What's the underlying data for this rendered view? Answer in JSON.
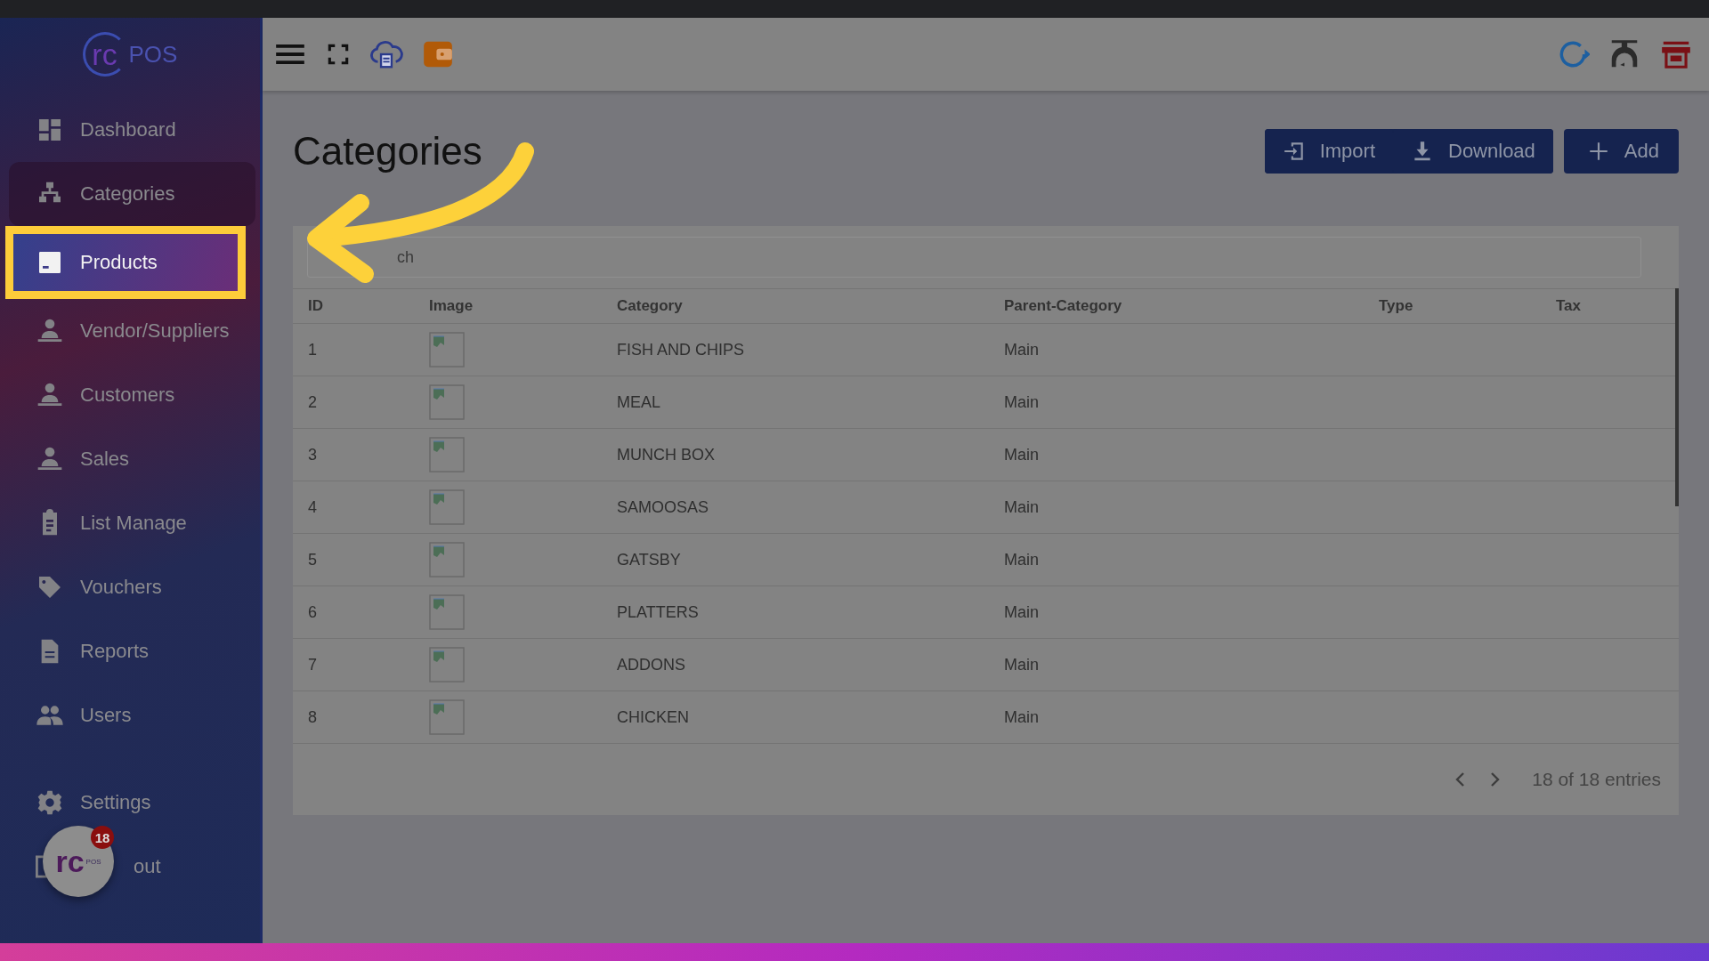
{
  "logo": {
    "mark": "rc",
    "text": "POS"
  },
  "sidebar": {
    "items": [
      {
        "label": "Dashboard",
        "selected": false,
        "hovered": false
      },
      {
        "label": "Categories",
        "selected": false,
        "hovered": true
      },
      {
        "label": "Products",
        "selected": true,
        "hovered": false
      },
      {
        "label": "Vendor/Suppliers",
        "selected": false,
        "hovered": false
      },
      {
        "label": "Customers",
        "selected": false,
        "hovered": false
      },
      {
        "label": "Sales",
        "selected": false,
        "hovered": false
      },
      {
        "label": "List Manage",
        "selected": false,
        "hovered": false
      },
      {
        "label": "Vouchers",
        "selected": false,
        "hovered": false
      },
      {
        "label": "Reports",
        "selected": false,
        "hovered": false
      },
      {
        "label": "Users",
        "selected": false,
        "hovered": false
      }
    ],
    "bottom_items": [
      {
        "label": "Settings"
      },
      {
        "label": "out"
      }
    ]
  },
  "floating_badge": {
    "mark": "rc",
    "text": "POS",
    "count": "18"
  },
  "page": {
    "title": "Categories",
    "buttons": [
      "Import",
      "Download",
      "Add"
    ]
  },
  "search": {
    "placeholder": "ch"
  },
  "table": {
    "columns": [
      "ID",
      "Image",
      "Category",
      "Parent-Category",
      "Type",
      "Tax"
    ],
    "rows": [
      {
        "id": "1",
        "category": "FISH AND CHIPS",
        "parent": "Main"
      },
      {
        "id": "2",
        "category": "MEAL",
        "parent": "Main"
      },
      {
        "id": "3",
        "category": "MUNCH BOX",
        "parent": "Main"
      },
      {
        "id": "4",
        "category": "SAMOOSAS",
        "parent": "Main"
      },
      {
        "id": "5",
        "category": "GATSBY",
        "parent": "Main"
      },
      {
        "id": "6",
        "category": "PLATTERS",
        "parent": "Main"
      },
      {
        "id": "7",
        "category": "ADDONS",
        "parent": "Main"
      },
      {
        "id": "8",
        "category": "CHICKEN",
        "parent": "Main"
      }
    ]
  },
  "pagination": {
    "entries": "18 of 18 entries"
  }
}
